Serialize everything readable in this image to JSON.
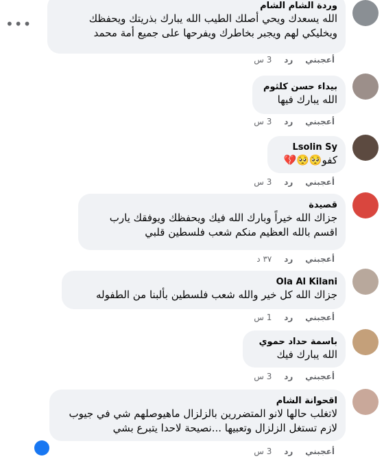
{
  "comments": [
    {
      "author": "وردة الشام الشام",
      "lines": [
        "الله يسعدك ويحي أصلك الطيب الله يبارك بذريتك ويحفظك",
        "ويخليكي لهم ويجبر بخاطرك ويفرحها على جميع أمة محمد"
      ],
      "like": "أعجبني",
      "reply": "رد",
      "time": "3 س"
    },
    {
      "author": "بيداء حسن كلثوم",
      "lines": [
        "الله يبارك فيها"
      ],
      "like": "أعجبني",
      "reply": "رد",
      "time": "3 س"
    },
    {
      "author": "Lsolin Sy",
      "lines": [
        "كفو🥺🥺💔"
      ],
      "like": "أعجبني",
      "reply": "رد",
      "time": "3 س"
    },
    {
      "author": "قصيدة",
      "lines": [
        "جزاك الله خيراً وبارك الله فيك ويحفظك ويوفقك يارب",
        "اقسم بالله العظيم منكم شعب فلسطين قلبي"
      ],
      "like": "أعجبني",
      "reply": "رد",
      "time": "٣٧ د"
    },
    {
      "author": "Ola Al Kilani",
      "lines": [
        "جزاك الله كل خير والله شعب فلسطين بألبنا من الطفوله"
      ],
      "like": "أعجبني",
      "reply": "رد",
      "time": "1 س"
    },
    {
      "author": "باسمة حداد حموي",
      "lines": [
        "الله يبارك فيك"
      ],
      "like": "أعجبني",
      "reply": "رد",
      "time": "3 س"
    },
    {
      "author": "اقحوانة الشام",
      "lines": [
        "لاتغلب حالها لانو المتضررين بالزلزال ماهيوصلهم شي في جيوب",
        "لازم تستغل الزلزال وتعبيها ...نصيحة لاحدا يتبرع بشي"
      ],
      "like": "أعجبني",
      "reply": "رد",
      "time": "3 س"
    }
  ],
  "colors": {
    "bubble": "#f0f2f5",
    "meta": "#65676b",
    "text": "#050505",
    "reaction": "#1877f2"
  }
}
